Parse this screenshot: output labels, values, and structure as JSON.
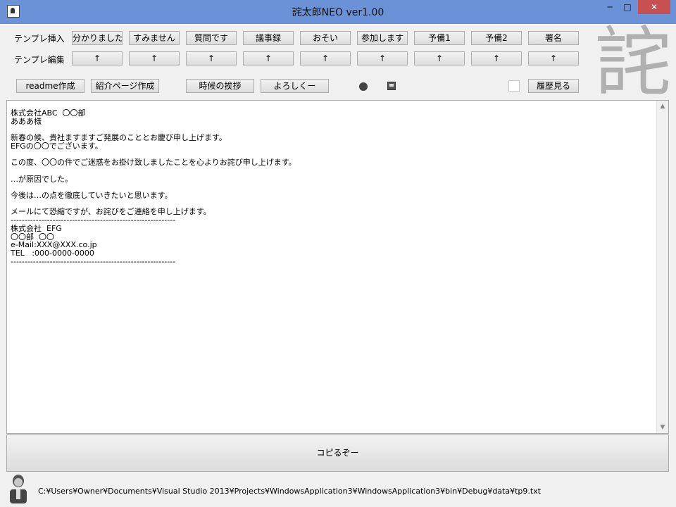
{
  "window": {
    "title": "詫太郎NEO  ver1.00",
    "minimize_label": "─",
    "maximize_label": "□",
    "close_label": "✕"
  },
  "toolbar": {
    "insert_label": "テンプレ挿入",
    "edit_label": "テンプレ編集",
    "templates": [
      "分かりました",
      "すみません",
      "質問です",
      "議事録",
      "おそい",
      "参加します",
      "予備1",
      "予備2",
      "署名"
    ],
    "edit_buttons": [
      "↑",
      "↑",
      "↑",
      "↑",
      "↑",
      "↑",
      "↑",
      "↑",
      "↑"
    ],
    "readme_label": "readme作成",
    "intro_label": "紹介ページ作成",
    "season_label": "時候の挨拶",
    "regards_label": "よろしくー",
    "history_label": "履歴見る",
    "watermark": "詫"
  },
  "editor": {
    "content": "株式会社ABC  〇〇部\nあああ様\n\n新春の候、貴社ますますご発展のこととお慶び申し上げます。\nEFGの〇〇でございます。\n\nこの度、〇〇の件でご迷惑をお掛け致しましたことを心よりお詫び申し上げます。\n\n…が原因でした。\n\n今後は…の点を徹底していきたいと思います。\n\nメールにて恐縮ですが、お詫びをご連絡を申し上げます。\n-----------------------------------------------------------\n株式会社  EFG\n〇〇部  〇〇\ne-Mail:XXX@XXX.co.jp\nTEL   :000-0000-0000\n-----------------------------------------------------------"
  },
  "copy_button_label": "コピるぞー",
  "status_path": "C:¥Users¥Owner¥Documents¥Visual Studio 2013¥Projects¥WindowsApplication3¥WindowsApplication3¥bin¥Debug¥data¥tp9.txt"
}
